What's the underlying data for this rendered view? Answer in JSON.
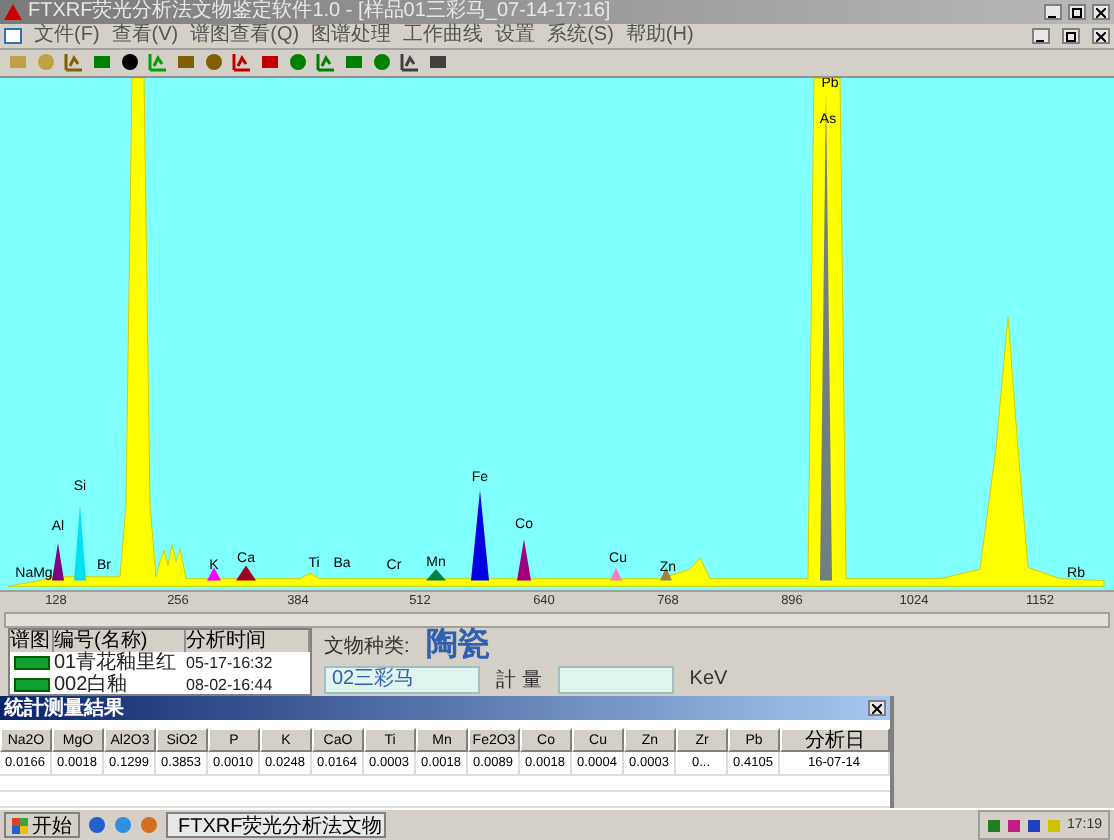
{
  "window": {
    "title": "FTXRF荧光分析法文物鉴定软件1.0 - [样品01三彩马_07-14-17:16]"
  },
  "menu": [
    "文件(F)",
    "查看(V)",
    "谱图查看(Q)",
    "图谱处理",
    "工作曲线",
    "设置",
    "系统(S)",
    "帮助(H)"
  ],
  "spectrum": {
    "peaks": [
      {
        "label": "NaMg"
      },
      {
        "label": "Al",
        "color": "#800080"
      },
      {
        "label": "Si",
        "color": "#00e0f0"
      },
      {
        "label": "Br"
      },
      {
        "label": "K",
        "color": "#ff00ff"
      },
      {
        "label": "Ca",
        "color": "#a00020"
      },
      {
        "label": "Ti"
      },
      {
        "label": "Ba"
      },
      {
        "label": "Cr"
      },
      {
        "label": "Mn",
        "color": "#008040"
      },
      {
        "label": "Fe",
        "color": "#0000e0"
      },
      {
        "label": "Co",
        "color": "#a00080"
      },
      {
        "label": "Cu",
        "color": "#ff80c0"
      },
      {
        "label": "Zn",
        "color": "#a08040"
      },
      {
        "label": "Pb",
        "color": "#708080"
      },
      {
        "label": "As"
      },
      {
        "label": "Rb"
      }
    ],
    "axis_labels": [
      "128",
      "256",
      "384",
      "512",
      "640",
      "768",
      "896",
      "1024",
      "1152"
    ]
  },
  "sample_list": {
    "columns": [
      "谱图",
      "编号(名称)",
      "分析时间"
    ],
    "rows": [
      {
        "name": "01青花釉里红",
        "time": "05-17-16:32"
      },
      {
        "name": "002白釉",
        "time": "08-02-16:44"
      }
    ]
  },
  "info": {
    "type_label": "文物种类:",
    "type_value": "陶瓷",
    "sample_value": "02三彩马",
    "measure_label": "計 量",
    "unit": "KeV"
  },
  "results": {
    "title": "統計测量結果",
    "columns": [
      "Na2O",
      "MgO",
      "Al2O3",
      "SiO2",
      "P",
      "K",
      "CaO",
      "Ti",
      "Mn",
      "Fe2O3",
      "Co",
      "Cu",
      "Zn",
      "Zr",
      "Pb",
      "分析日"
    ],
    "rows": [
      [
        "0.0166",
        "0.0018",
        "0.1299",
        "0.3853",
        "0.0010",
        "0.0248",
        "0.0164",
        "0.0003",
        "0.0018",
        "0.0089",
        "0.0018",
        "0.0004",
        "0.0003",
        "0...",
        "0.4105",
        "16-07-14"
      ]
    ]
  },
  "taskbar": {
    "start": "开始",
    "task": "FTXRF荧光分析法文物",
    "clock": "17:19"
  }
}
